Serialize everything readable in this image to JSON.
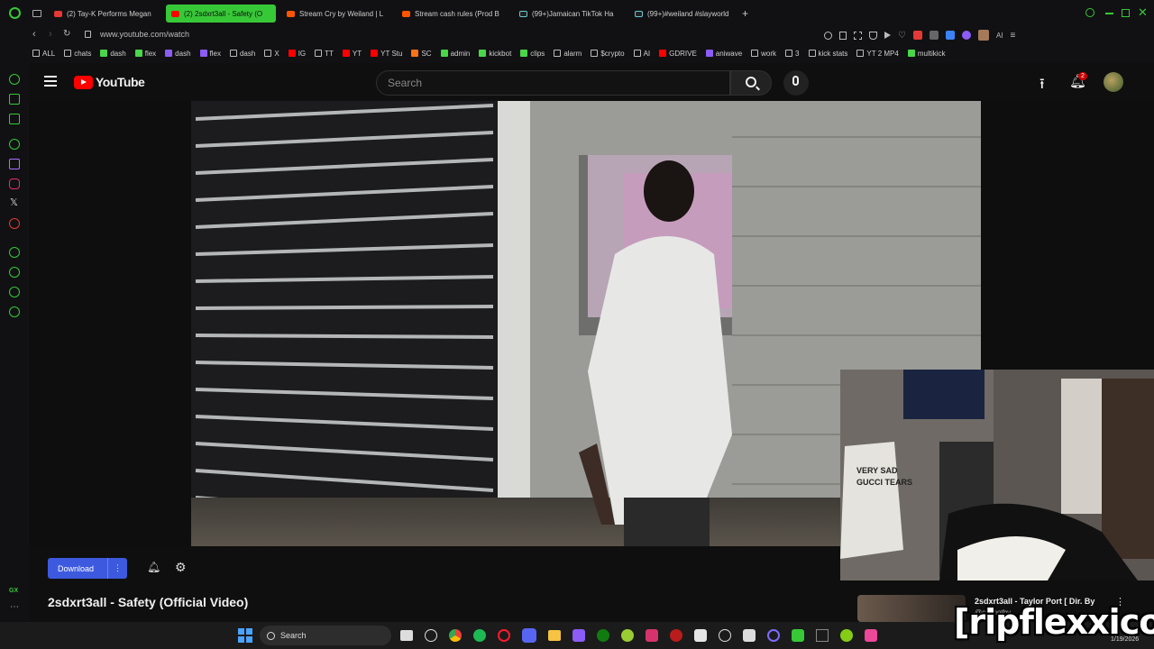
{
  "browser": {
    "tabs": [
      {
        "label": "(2) Tay-K Performs Megan",
        "icon": "youtube-icon",
        "active": false
      },
      {
        "label": "(2) 2sdxrt3all - Safety (O",
        "icon": "youtube-icon",
        "active": true
      },
      {
        "label": "Stream Cry by Weiland | L",
        "icon": "soundcloud-icon",
        "active": false
      },
      {
        "label": "Stream cash rules (Prod B",
        "icon": "soundcloud-icon",
        "active": false
      },
      {
        "label": "(99+)Jamaican TikTok Ha",
        "icon": "tiktok-icon",
        "active": false
      },
      {
        "label": "(99+)#weiland #slayworld",
        "icon": "tiktok-icon",
        "active": false
      }
    ],
    "url": "www.youtube.com/watch",
    "bookmarks": [
      {
        "label": "ALL",
        "color": "folder"
      },
      {
        "label": "chats",
        "color": "folder"
      },
      {
        "label": "dash",
        "color": "g"
      },
      {
        "label": "flex",
        "color": "g"
      },
      {
        "label": "dash",
        "color": "p"
      },
      {
        "label": "flex",
        "color": "p"
      },
      {
        "label": "dash",
        "color": "x"
      },
      {
        "label": "X",
        "color": "x"
      },
      {
        "label": "IG",
        "color": "r"
      },
      {
        "label": "TT",
        "color": "x"
      },
      {
        "label": "YT",
        "color": "r"
      },
      {
        "label": "YT Stu",
        "color": "r"
      },
      {
        "label": "SC",
        "color": "o"
      },
      {
        "label": "admin",
        "color": "g"
      },
      {
        "label": "kickbot",
        "color": "g"
      },
      {
        "label": "clips",
        "color": "g"
      },
      {
        "label": "alarm",
        "color": "x"
      },
      {
        "label": "$crypto",
        "color": "folder"
      },
      {
        "label": "AI",
        "color": "folder"
      },
      {
        "label": "GDRIVE",
        "color": "r"
      },
      {
        "label": "aniwave",
        "color": "p"
      },
      {
        "label": "work",
        "color": "folder"
      },
      {
        "label": "3",
        "color": "x"
      },
      {
        "label": "kick stats",
        "color": "x"
      },
      {
        "label": "YT 2 MP4",
        "color": "x"
      },
      {
        "label": "multikick",
        "color": "g"
      }
    ],
    "sidebar_label": "GX"
  },
  "youtube": {
    "logo": "YouTube",
    "search_placeholder": "Search",
    "notification_count": "2",
    "download_label": "Download",
    "title": "2sdxrt3all - Safety (Official Video)",
    "suggested_title": "2sdxrt3all - Taylor Port [ Dir. By",
    "suggested_channel": "@cashotby",
    "overlay": "[ripflexxico]"
  },
  "taskbar": {
    "search_label": "Search",
    "time": "",
    "date": "1/19/2026"
  },
  "colors": {
    "accent": "#37c837",
    "yt_red": "#ff0000",
    "download_btn": "#3d5adf"
  }
}
